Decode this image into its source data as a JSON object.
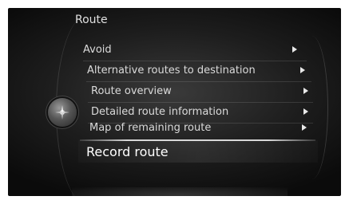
{
  "header": {
    "title": "Route"
  },
  "menu": {
    "items": [
      {
        "label": "Avoid",
        "has_submenu": true
      },
      {
        "label": "Alternative routes to destination",
        "has_submenu": true
      },
      {
        "label": "Route overview",
        "has_submenu": true
      },
      {
        "label": "Detailed route information",
        "has_submenu": true
      },
      {
        "label": "Map of remaining route",
        "has_submenu": true
      },
      {
        "label": "Record route",
        "has_submenu": false,
        "selected": true
      }
    ]
  },
  "icons": {
    "knob": "navigation-compass-icon",
    "submenu": "submenu-arrow-icon"
  },
  "colors": {
    "background": "#1d1d1d",
    "text": "#dadada",
    "selected_text": "#ffffff"
  }
}
